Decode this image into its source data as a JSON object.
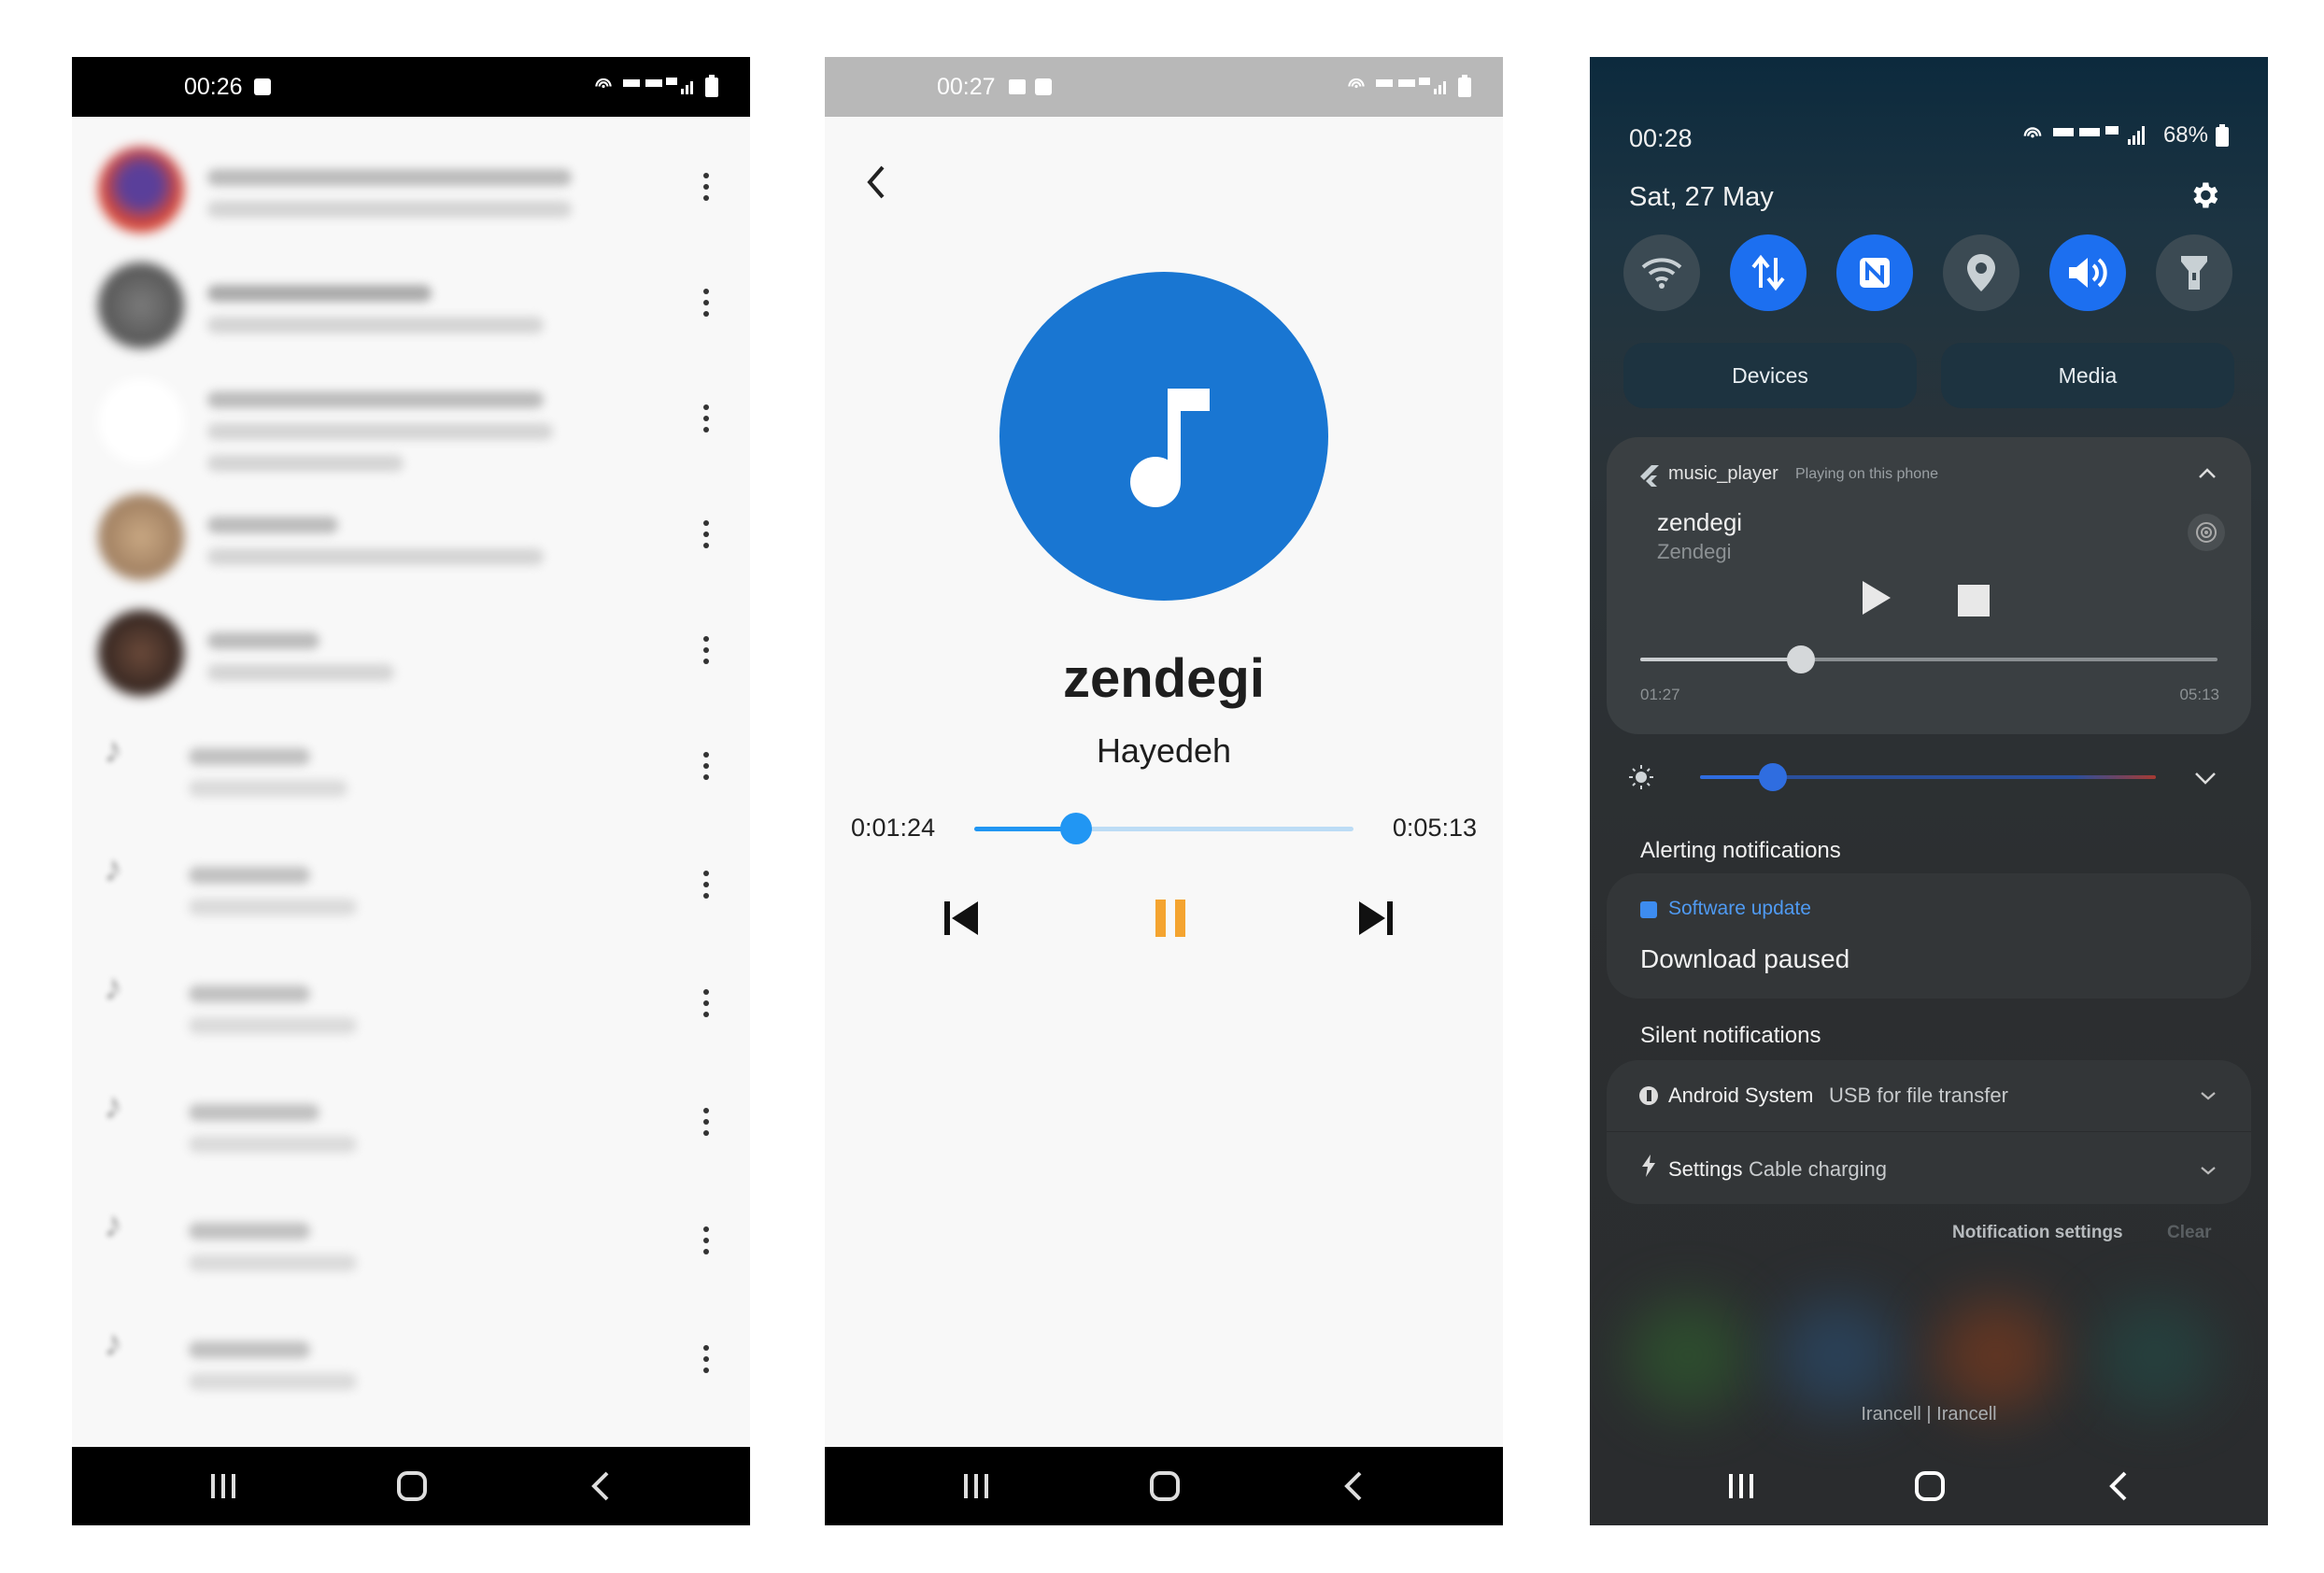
{
  "screen1": {
    "status_time": "00:26",
    "row_count": 11
  },
  "screen2": {
    "status_time": "00:27",
    "song_title": "zendegi",
    "artist": "Hayedeh",
    "position": "0:01:24",
    "duration": "0:05:13",
    "progress": 0.268,
    "colors": {
      "disc": "#1976d2",
      "pause": "#f4a430",
      "slider": "#2196f3"
    }
  },
  "screen3": {
    "status_time": "00:28",
    "battery": "68%",
    "date": "Sat, 27 May",
    "quick_settings": [
      "wifi-icon",
      "mobile-data-icon",
      "nfc-icon",
      "location-icon",
      "sound-icon",
      "flashlight-icon"
    ],
    "devices_label": "Devices",
    "media_label": "Media",
    "media": {
      "app_name": "music_player",
      "subtitle": "Playing on this phone",
      "title": "zendegi",
      "artist": "Zendegi",
      "position": "01:27",
      "duration": "05:13",
      "progress": 0.278
    },
    "brightness": 0.16,
    "alerting_header": "Alerting notifications",
    "software_update": {
      "app": "Software update",
      "text": "Download paused"
    },
    "silent_header": "Silent notifications",
    "silent_items": [
      {
        "app": "Android System",
        "text": "USB for file transfer"
      },
      {
        "app": "Settings",
        "text": "Cable charging"
      }
    ],
    "notification_settings": "Notification settings",
    "clear": "Clear",
    "carrier": "Irancell | Irancell"
  }
}
